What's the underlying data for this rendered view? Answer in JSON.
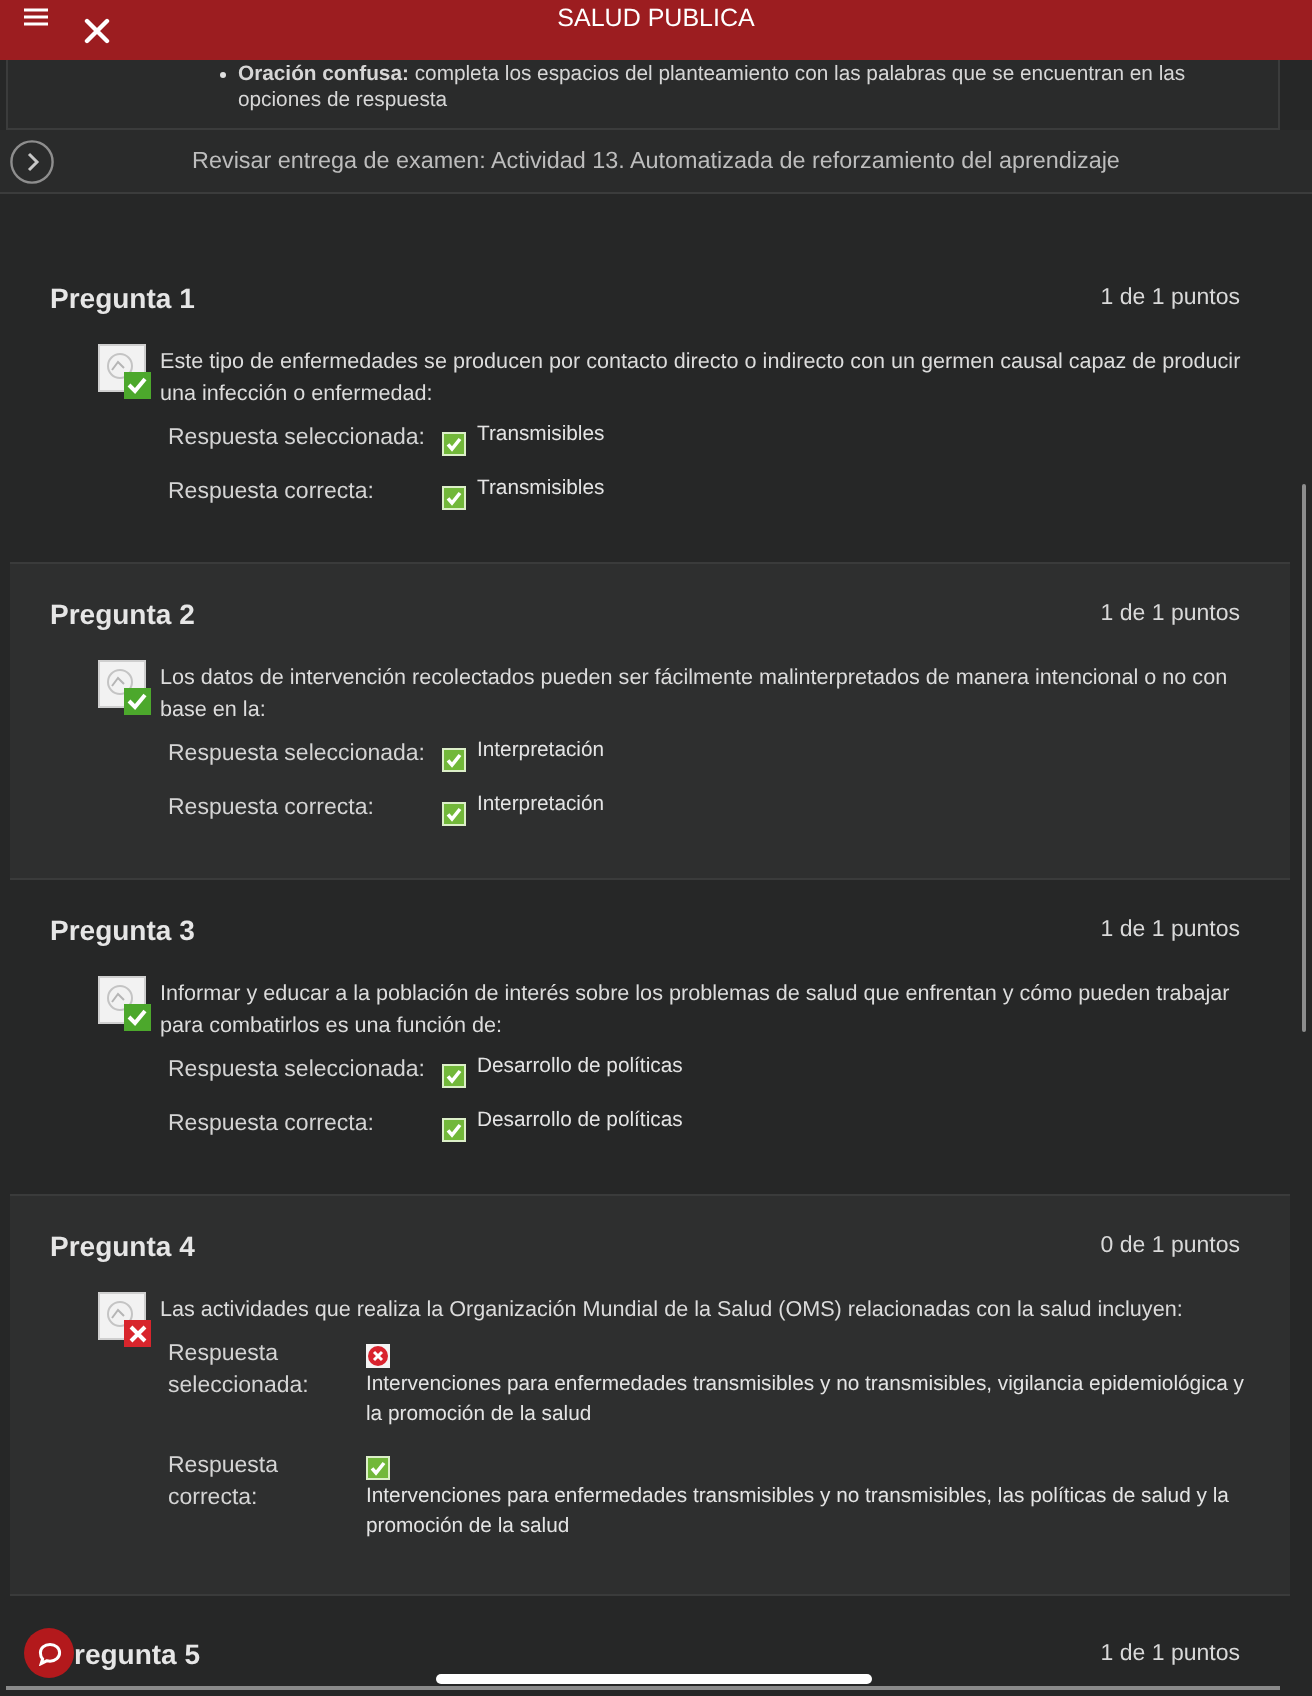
{
  "header": {
    "title": "SALUD PUBLICA"
  },
  "instructions": [
    {
      "text": "**Oración confusa:** completa los espacios del planteamiento con las palabras que se encuentran en las opciones de respuesta"
    }
  ],
  "review_bar": {
    "title": "Revisar entrega de examen: Actividad 13. Automatizada de reforzamiento del aprendizaje"
  },
  "questions": [
    {
      "kind": "inline",
      "title": "Pregunta 1",
      "points": "1 de 1 puntos",
      "covered_by_chat_button": false,
      "correct": true,
      "text": "Este tipo de enfermedades se producen por contacto directo o indirecto con un germen causal capaz de producir una infección o enfermedad:",
      "answers": [
        {
          "label": "Respuesta seleccionada:",
          "correct": true,
          "text": "Transmisibles"
        },
        {
          "label": "Respuesta correcta:",
          "correct": true,
          "text": "Transmisibles"
        }
      ]
    },
    {
      "kind": "inline",
      "title": "Pregunta 2",
      "points": "1 de 1 puntos",
      "covered_by_chat_button": false,
      "correct": true,
      "text": "Los datos de intervención recolectados pueden ser fácilmente malinterpretados de manera intencional o no con base en la:",
      "answers": [
        {
          "label": "Respuesta seleccionada:",
          "correct": true,
          "text": "Interpretación"
        },
        {
          "label": "Respuesta correcta:",
          "correct": true,
          "text": "Interpretación"
        }
      ]
    },
    {
      "kind": "inline",
      "title": "Pregunta 3",
      "points": "1 de 1 puntos",
      "covered_by_chat_button": false,
      "correct": true,
      "text": "Informar y educar a la población de interés sobre los problemas de salud que enfrentan y cómo pueden trabajar para combatirlos es una función de:",
      "answers": [
        {
          "label": "Respuesta seleccionada:",
          "correct": true,
          "text": "Desarrollo de políticas"
        },
        {
          "label": "Respuesta correcta:",
          "correct": true,
          "text": "Desarrollo de políticas"
        }
      ]
    },
    {
      "kind": "stacked",
      "title": "Pregunta 4",
      "points": "0 de 1 puntos",
      "covered_by_chat_button": false,
      "correct": false,
      "text": "Las actividades que realiza la Organización Mundial de la Salud (OMS) relacionadas con la salud incluyen:",
      "answers": [
        {
          "label": "Respuesta seleccionada:",
          "correct": false,
          "text": "Intervenciones para enfermedades transmisibles y no transmisibles, vigilancia epidemiológica y la promoción de la salud"
        },
        {
          "label": "Respuesta correcta:",
          "correct": true,
          "text": "Intervenciones para enfermedades transmisibles y no transmisibles, las políticas de salud y la promoción de la salud"
        }
      ]
    },
    {
      "title": "regunta 5",
      "points": "1 de 1 puntos",
      "covered_by_chat_button": true
    }
  ]
}
